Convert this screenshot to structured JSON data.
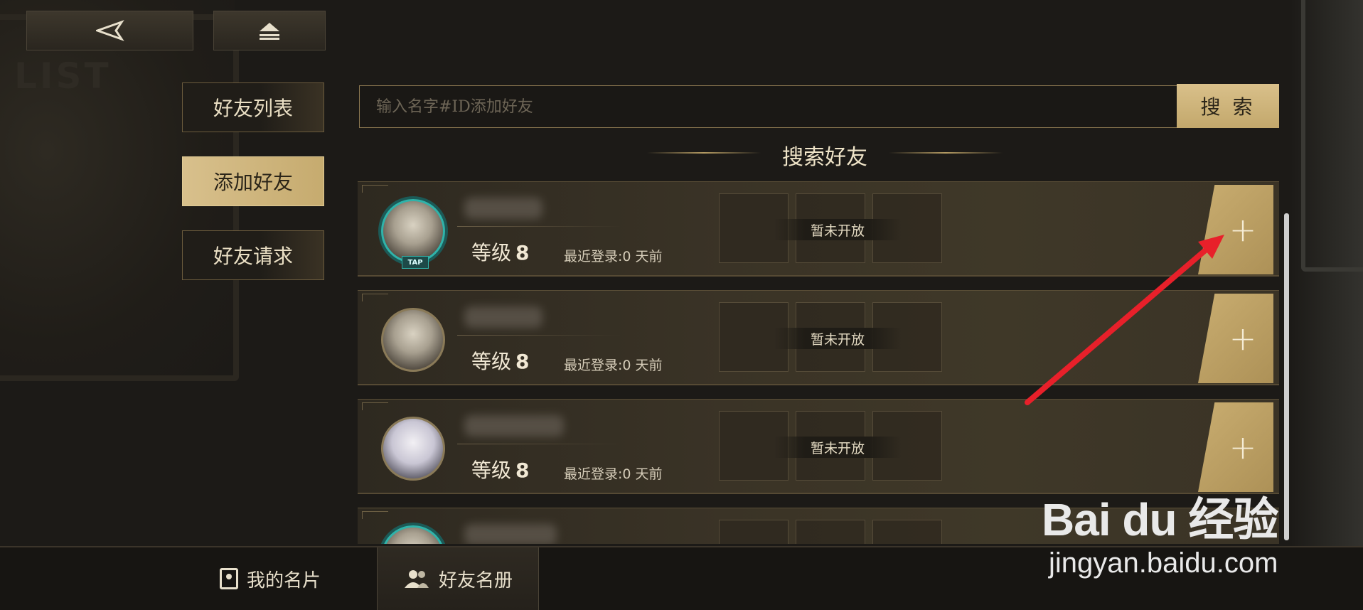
{
  "top_buttons": {
    "back_icon": "back-triangle-icon",
    "home_icon": "eject-icon"
  },
  "background_text": "LIST",
  "sidebar": {
    "items": [
      {
        "label": "好友列表",
        "active": false
      },
      {
        "label": "添加好友",
        "active": true
      },
      {
        "label": "好友请求",
        "active": false
      }
    ]
  },
  "search": {
    "placeholder": "输入名字#ID添加好友",
    "value": "",
    "button_label": "搜 索"
  },
  "section_title": "搜索好友",
  "results": [
    {
      "level_label": "等级",
      "level": "8",
      "last_login": "最近登录:0 天前",
      "slot_status": "暂未开放",
      "tap_badge": "TAP",
      "add_symbol": "+"
    },
    {
      "level_label": "等级",
      "level": "8",
      "last_login": "最近登录:0 天前",
      "slot_status": "暂未开放",
      "add_symbol": "+"
    },
    {
      "level_label": "等级",
      "level": "8",
      "last_login": "最近登录:0 天前",
      "slot_status": "暂未开放",
      "add_symbol": "+"
    }
  ],
  "bottom_nav": {
    "my_card": "我的名片",
    "friend_roster": "好友名册"
  },
  "watermark": {
    "brand": "Bai du 经验",
    "url": "jingyan.baidu.com"
  },
  "colors": {
    "accent_gold": "#c9ad70",
    "annotation_arrow": "#e8202a",
    "avatar_ring_teal": "#2fb3aa"
  }
}
